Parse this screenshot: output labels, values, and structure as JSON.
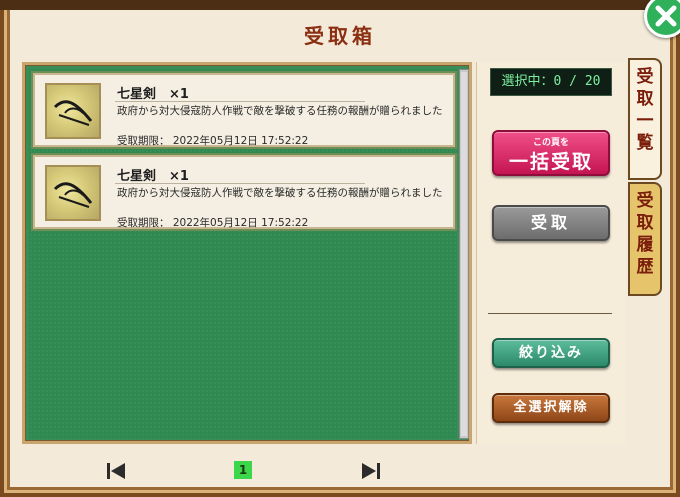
{
  "window": {
    "title": "受取箱"
  },
  "selection": {
    "counter": "選択中：0 / 20"
  },
  "items": [
    {
      "name": "七星剣　×1",
      "description": "政府から対大侵寇防人作戦で敵を撃破する任務の報酬が贈られました",
      "deadline": "受取期限： 2022年05月12日 17:52:22",
      "icon": "sword-icon"
    },
    {
      "name": "七星剣　×1",
      "description": "政府から対大侵寇防人作戦で敵を撃破する任務の報酬が贈られました",
      "deadline": "受取期限： 2022年05月12日 17:52:22",
      "icon": "sword-icon"
    }
  ],
  "buttons": {
    "bulk_receive_small": "この頁を",
    "bulk_receive": "一括受取",
    "receive": "受取",
    "filter": "絞り込み",
    "deselect_all": "全選択解除"
  },
  "tabs": {
    "received_list": [
      "受",
      "取",
      "一",
      "覧"
    ],
    "receive_history": [
      "受",
      "取",
      "履",
      "歴"
    ]
  },
  "pagination": {
    "current_page": "1"
  },
  "colors": {
    "accent_pink": "#c41552",
    "list_green": "#2f8a52",
    "close_green": "#2fb05a"
  }
}
